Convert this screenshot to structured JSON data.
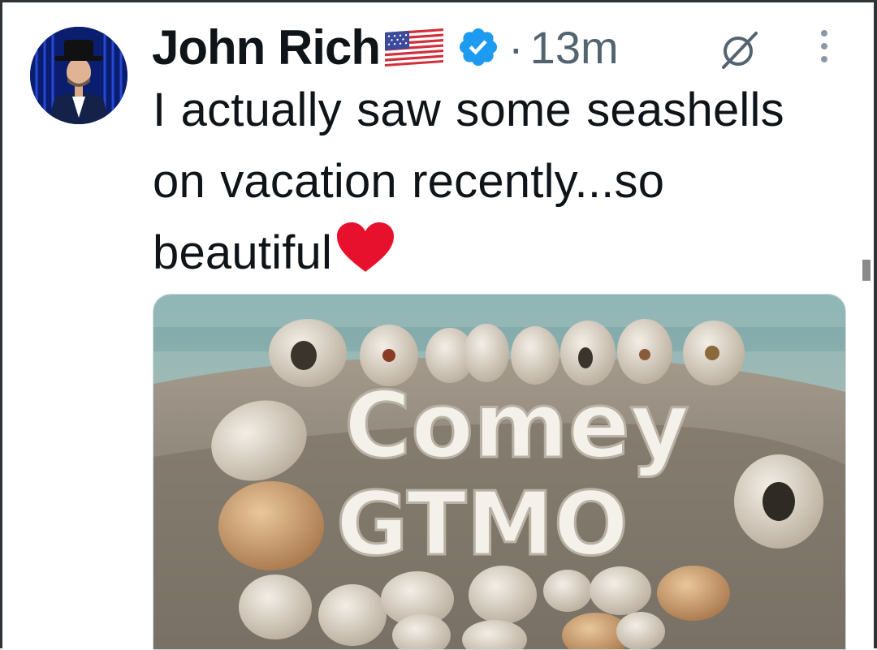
{
  "post": {
    "author_name": "John Rich",
    "separator": "·",
    "timestamp": "13m",
    "text": "I actually saw some seashells on vacation recently...so beautiful",
    "media": {
      "shell_text_line1": "Comey",
      "shell_text_line2": "GTMO"
    }
  },
  "icons": {
    "flag": "us-flag-emoji",
    "verified": "verified-badge-icon",
    "heart": "red-heart-emoji",
    "grok": "grok-icon",
    "more": "more-vertical-icon"
  },
  "colors": {
    "verified_blue": "#1d9bf0",
    "text_primary": "#0f1419",
    "text_secondary": "#536471",
    "heart_red": "#e8112d"
  }
}
